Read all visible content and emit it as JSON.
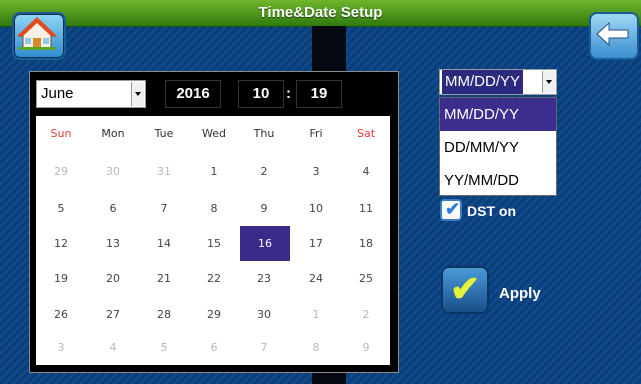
{
  "window": {
    "title": "Time&Date Setup"
  },
  "date": {
    "month": "June",
    "year": "2016",
    "hour": "10",
    "colon": ":",
    "minute": "19"
  },
  "calendar": {
    "weekdays": [
      "Sun",
      "Mon",
      "Tue",
      "Wed",
      "Thu",
      "Fri",
      "Sat"
    ],
    "weeks": [
      [
        "29",
        "30",
        "31",
        "1",
        "2",
        "3",
        "4"
      ],
      [
        "5",
        "6",
        "7",
        "8",
        "9",
        "10",
        "11"
      ],
      [
        "12",
        "13",
        "14",
        "15",
        "16",
        "17",
        "18"
      ],
      [
        "19",
        "20",
        "21",
        "22",
        "23",
        "24",
        "25"
      ],
      [
        "26",
        "27",
        "28",
        "29",
        "30",
        "1",
        "2"
      ],
      [
        "3",
        "4",
        "5",
        "6",
        "7",
        "8",
        "9"
      ]
    ],
    "selected_day": "16"
  },
  "date_format": {
    "selected": "MM/DD/YY",
    "options": [
      "MM/DD/YY",
      "DD/MM/YY",
      "YY/MM/DD"
    ],
    "highlighted": "MM/DD/YY"
  },
  "dst": {
    "label": "DST on",
    "checked": true
  },
  "apply": {
    "label": "Apply"
  },
  "icons": {
    "home": "home-icon",
    "back": "back-arrow-icon",
    "check": "check-icon"
  },
  "colors": {
    "title_green": "#4f9a1e",
    "selection": "#3a2a8a",
    "weekend_red": "#e23a3a",
    "background_blue": "#0b3e79"
  }
}
